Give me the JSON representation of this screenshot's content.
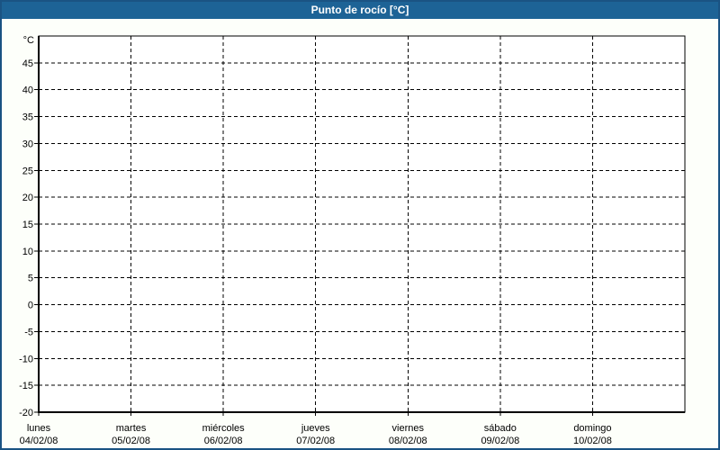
{
  "window": {
    "title": "Punto de rocío [°C]"
  },
  "colors": {
    "title_bar_bg": "#1d6396",
    "title_text": "#ffffff",
    "window_border": "#1a5383",
    "page_bg": "#fdfffa",
    "plot_bg": "#ffffff",
    "grid_color": "#000000",
    "text_color": "#000000"
  },
  "chart_data": {
    "type": "line",
    "title": "Punto de rocío [°C]",
    "y_unit_label": "°C",
    "ylim": [
      -20,
      50
    ],
    "y_tick_step": 5,
    "y_tick_labels": [
      45,
      40,
      35,
      30,
      25,
      20,
      15,
      10,
      5,
      0,
      -5,
      -10,
      -15,
      -20
    ],
    "x_days": [
      {
        "day": "lunes",
        "date": "04/02/08"
      },
      {
        "day": "martes",
        "date": "05/02/08"
      },
      {
        "day": "miércoles",
        "date": "06/02/08"
      },
      {
        "day": "jueves",
        "date": "07/02/08"
      },
      {
        "day": "viernes",
        "date": "08/02/08"
      },
      {
        "day": "sábado",
        "date": "09/02/08"
      },
      {
        "day": "domingo",
        "date": "10/02/08"
      }
    ],
    "grid": {
      "horizontal": "dashed",
      "vertical": "dashed"
    },
    "legend": "none",
    "series": []
  }
}
